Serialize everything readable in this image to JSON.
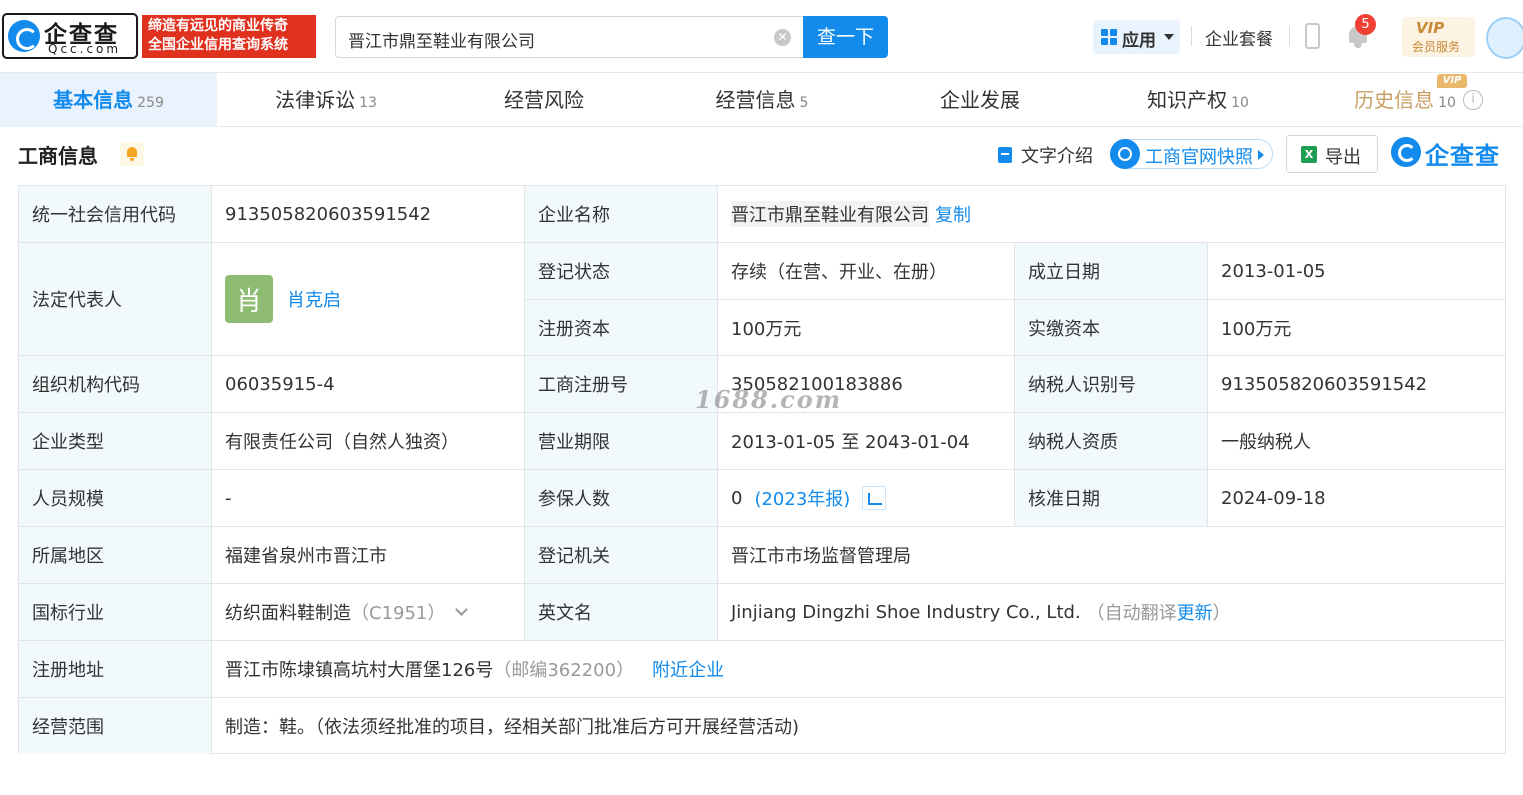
{
  "header": {
    "logo_cn": "企查查",
    "logo_en": "Qcc.com",
    "slogan_line1": "缔造有远见的商业传奇",
    "slogan_line2": "全国企业信用查询系统",
    "search_value": "晋江市鼎至鞋业有限公司",
    "search_button": "查一下",
    "app_label": "应用",
    "package_label": "企业套餐",
    "notification_count": "5",
    "vip_line1": "VIP",
    "vip_line2": "会员服务"
  },
  "tabs": [
    {
      "label": "基本信息",
      "count": "259",
      "active": true
    },
    {
      "label": "法律诉讼",
      "count": "13"
    },
    {
      "label": "经营风险",
      "count": ""
    },
    {
      "label": "经营信息",
      "count": "5"
    },
    {
      "label": "企业发展",
      "count": ""
    },
    {
      "label": "知识产权",
      "count": "10"
    },
    {
      "label": "历史信息",
      "count": "10",
      "vip_tag": "VIP"
    }
  ],
  "section": {
    "title": "工商信息",
    "text_intro": "文字介绍",
    "official_snapshot": "工商官网快照",
    "export": "导出",
    "brand": "企查查"
  },
  "company": {
    "credit_code_label": "统一社会信用代码",
    "credit_code": "913505820603591542",
    "name_label": "企业名称",
    "name": "晋江市鼎至鞋业有限公司",
    "copy": "复制",
    "legal_rep_label": "法定代表人",
    "legal_rep_avatar": "肖",
    "legal_rep": "肖克启",
    "status_label": "登记状态",
    "status": "存续（在营、开业、在册）",
    "founded_label": "成立日期",
    "founded": "2013-01-05",
    "reg_capital_label": "注册资本",
    "reg_capital": "100万元",
    "paid_capital_label": "实缴资本",
    "paid_capital": "100万元",
    "org_code_label": "组织机构代码",
    "org_code": "06035915-4",
    "reg_no_label": "工商注册号",
    "reg_no": "350582100183886",
    "taxpayer_id_label": "纳税人识别号",
    "taxpayer_id": "913505820603591542",
    "type_label": "企业类型",
    "type": "有限责任公司（自然人独资）",
    "term_label": "营业期限",
    "term": "2013-01-05 至 2043-01-04",
    "taxpayer_qual_label": "纳税人资质",
    "taxpayer_qual": "一般纳税人",
    "staff_label": "人员规模",
    "staff": "-",
    "insured_label": "参保人数",
    "insured": "0",
    "insured_year": "(2023年报)",
    "approved_label": "核准日期",
    "approved": "2024-09-18",
    "region_label": "所属地区",
    "region": "福建省泉州市晋江市",
    "authority_label": "登记机关",
    "authority": "晋江市市场监督管理局",
    "industry_label": "国标行业",
    "industry": "纺织面料鞋制造",
    "industry_code": "（C1951）",
    "english_label": "英文名",
    "english": "Jinjiang Dingzhi Shoe Industry Co., Ltd.",
    "english_note_pre": "（自动翻译",
    "english_update": "更新",
    "english_note_post": "）",
    "address_label": "注册地址",
    "address": "晋江市陈埭镇高坑村大厝堡126号",
    "postcode": "（邮编362200）",
    "nearby": "附近企业",
    "scope_label": "经营范围",
    "scope": "制造：鞋。（依法须经批准的项目，经相关部门批准后方可开展经营活动)"
  },
  "watermark": "1688.com",
  "colors": {
    "accent": "#128bed",
    "label_bg": "#f2f9fc",
    "slogan_bg": "#e0301e",
    "vip": "#c9893a"
  }
}
